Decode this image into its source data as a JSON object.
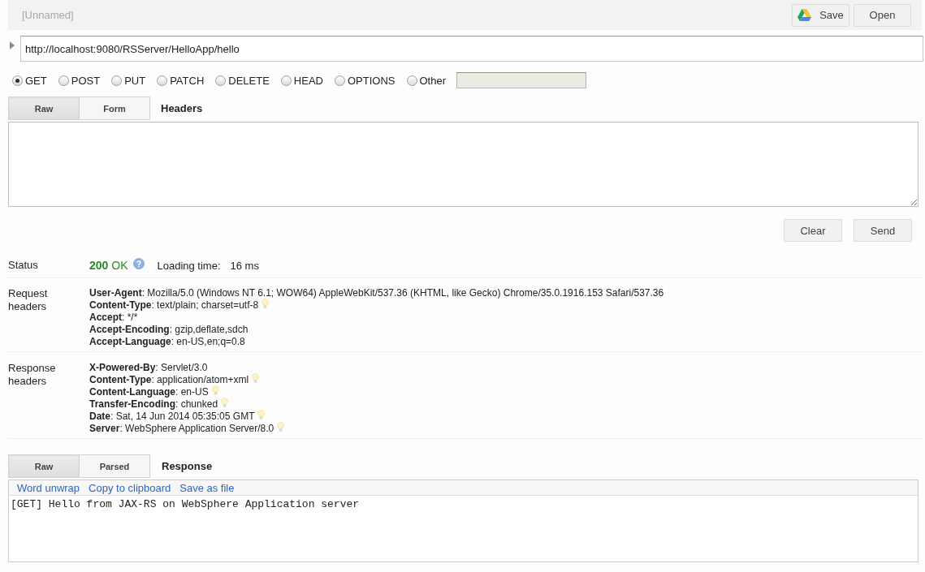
{
  "title": "[Unnamed]",
  "toolbar_buttons": [
    {
      "kind": "drive",
      "label": "Save"
    },
    {
      "kind": "plain",
      "label": "Open"
    }
  ],
  "request": {
    "expanded": false,
    "url": "http://localhost:9080/RSServer/HelloApp/hello"
  },
  "methods": [
    {
      "label": "GET",
      "selected": true
    },
    {
      "label": "POST",
      "selected": false
    },
    {
      "label": "PUT",
      "selected": false
    },
    {
      "label": "PATCH",
      "selected": false
    },
    {
      "label": "DELETE",
      "selected": false
    },
    {
      "label": "HEAD",
      "selected": false
    },
    {
      "label": "OPTIONS",
      "selected": false
    },
    {
      "label": "Other",
      "selected": false
    }
  ],
  "other_method_field": {
    "disabled": true
  },
  "headers_tabs": [
    {
      "label": "Raw",
      "selected": true
    },
    {
      "label": "Form",
      "selected": false
    }
  ],
  "headers_title": "Headers",
  "actions": [
    "Clear",
    "Send"
  ],
  "status": {
    "label": "Status",
    "result": "**200** OK",
    "loading_label": "Loading time:",
    "loading_value": "16 ms"
  },
  "request_headers": {
    "label": "Request headers",
    "items": [
      {
        "name": "User-Agent",
        "value": ": Mozilla/5.0 (Windows NT 6.1; WOW64) AppleWebKit/537.36 (KHTML, like Gecko) Chrome/35.0.1916.153 Safari/537.36",
        "hint": false
      },
      {
        "name": "Content-Type",
        "value": ": text/plain; charset=utf-8",
        "hint": true
      },
      {
        "name": "Accept",
        "value": ": */*",
        "hint": false
      },
      {
        "name": "Accept-Encoding",
        "value": ": gzip,deflate,sdch",
        "hint": false
      },
      {
        "name": "Accept-Language",
        "value": ": en-US,en;q=0.8",
        "hint": false
      }
    ]
  },
  "response_headers": {
    "label": "Response headers",
    "items": [
      {
        "name": "X-Powered-By",
        "value": ": Servlet/3.0",
        "hint": false
      },
      {
        "name": "Content-Type",
        "value": ": application/atom+xml",
        "hint": true
      },
      {
        "name": "Content-Language",
        "value": ": en-US",
        "hint": true
      },
      {
        "name": "Transfer-Encoding",
        "value": ": chunked",
        "hint": true
      },
      {
        "name": "Date",
        "value": ": Sat, 14 Jun 2014 05:35:05 GMT",
        "hint": true
      },
      {
        "name": "Server",
        "value": ": WebSphere Application Server/8.0",
        "hint": true
      }
    ]
  },
  "response_tabs": [
    {
      "label": "Raw",
      "selected": true
    },
    {
      "label": "Parsed",
      "selected": false
    }
  ],
  "response_title": "Response",
  "response_links": [
    "Word unwrap",
    "Copy to clipboard",
    "Save as file"
  ],
  "response_body": "[GET] Hello from JAX-RS on WebSphere Application server"
}
